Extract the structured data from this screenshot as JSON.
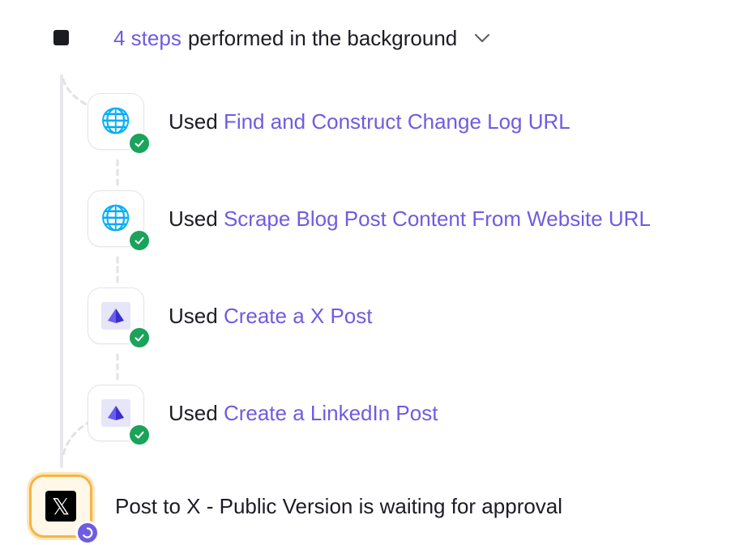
{
  "header": {
    "steps_count": "4 steps",
    "text": "performed in the background",
    "toggle_icon": "chevron-down-icon"
  },
  "steps": [
    {
      "prefix": "Used",
      "tool": "Find and Construct Change Log URL",
      "icon": "globe-icon",
      "status": "done"
    },
    {
      "prefix": "Used",
      "tool": "Scrape Blog Post Content From Website URL",
      "icon": "globe-icon",
      "status": "done"
    },
    {
      "prefix": "Used",
      "tool": "Create a X Post",
      "icon": "gem-icon",
      "status": "done"
    },
    {
      "prefix": "Used",
      "tool": "Create a LinkedIn Post",
      "icon": "gem-icon",
      "status": "done"
    }
  ],
  "approval": {
    "text": "Post to X - Public Version is waiting for approval",
    "icon": "x-logo-icon",
    "status_icon": "pending-icon"
  },
  "colors": {
    "accent": "#6f5ce0",
    "success": "#1aa35a",
    "warning": "#f3b545",
    "text": "#1c1c24"
  }
}
